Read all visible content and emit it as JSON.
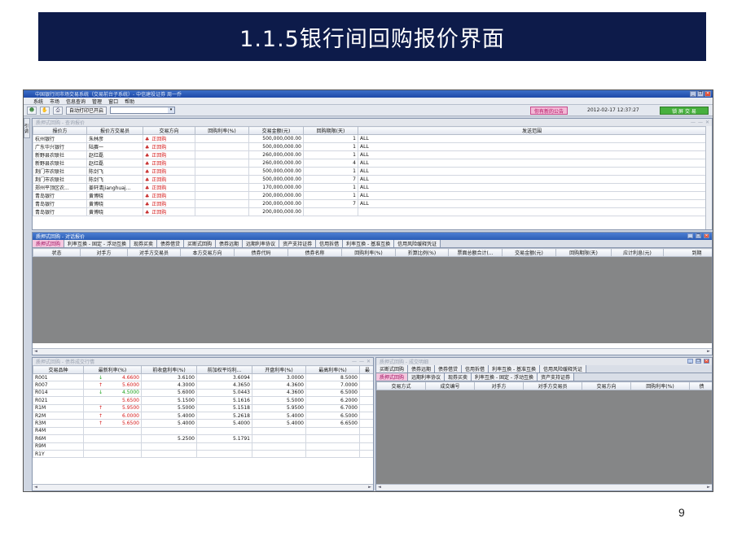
{
  "slide": {
    "title": "1.1.5银行间回购报价界面",
    "page_number": "9"
  },
  "app": {
    "window_title": "中国银行间市场交易系统（交易前台子系统）- 中信建投证券  周一乔",
    "menu": [
      "系统",
      "市场",
      "信息查询",
      "管理",
      "窗口",
      "帮助"
    ],
    "toolbar": {
      "auto_print_label": "自动打印已开启",
      "notice_label": "你有新的公告",
      "clock": "2012-02-17 12:37:27",
      "lock_label": "锁 屏 交 易"
    },
    "side_label": "引  调"
  },
  "quote_query": {
    "title": "质押式回购 - 查询报价",
    "columns": [
      "报价方",
      "报价方交易员",
      "交易方向",
      "回购利率(%)",
      "交易金额(元)",
      "回购期限(天)",
      "发送范围"
    ],
    "rows": [
      [
        "杭州银行",
        "朱林彦",
        "正回购",
        "",
        "500,000,000.00",
        "1",
        "ALL"
      ],
      [
        "广东华兴银行",
        "陆赛一",
        "正回购",
        "",
        "500,000,000.00",
        "1",
        "ALL"
      ],
      [
        "新野县农联社",
        "赵红磊",
        "正回购",
        "",
        "260,000,000.00",
        "1",
        "ALL"
      ],
      [
        "新野县农联社",
        "赵红磊",
        "正回购",
        "",
        "260,000,000.00",
        "4",
        "ALL"
      ],
      [
        "荆门市农联社",
        "陈剑飞",
        "正回购",
        "",
        "500,000,000.00",
        "1",
        "ALL"
      ],
      [
        "荆门市农联社",
        "陈剑飞",
        "正回购",
        "",
        "500,000,000.00",
        "7",
        "ALL"
      ],
      [
        "郑州平顶区农...",
        "姜轩清jianghuaj...",
        "正回购",
        "",
        "170,000,000.00",
        "1",
        "ALL"
      ],
      [
        "青岛银行",
        "黄博晓",
        "正回购",
        "",
        "200,000,000.00",
        "1",
        "ALL"
      ],
      [
        "青岛银行",
        "黄博晓",
        "正回购",
        "",
        "200,000,000.00",
        "7",
        "ALL"
      ],
      [
        "青岛银行",
        "黄博晓",
        "正回购",
        "",
        "200,000,000.00",
        "",
        ""
      ]
    ]
  },
  "dialog_quote": {
    "title": "质押式回购 - 对话报价",
    "tabs": [
      "质押式回购",
      "利率互换 - 固定 - 浮动互换",
      "现券买卖",
      "债券借贷",
      "买断式回购",
      "债券远期",
      "远期利率协议",
      "资产支持证券",
      "信用拆借",
      "利率互换 - 基准互换",
      "信用风险缓释凭证"
    ],
    "columns": [
      "状态",
      "对手方",
      "对手方交易员",
      "本方交易方向",
      "债券代码",
      "债券名称",
      "回购利率(%)",
      "折算比例(%)",
      "票面总额合计(...",
      "交易金额(元)",
      "回购期限(天)",
      "应计利息(元)",
      "到期"
    ]
  },
  "market": {
    "title": "质押式回购 - 债券成交行情",
    "columns": [
      "交易品种",
      "最新利率(%)",
      "前收盘利率(%)",
      "前加权平均利...",
      "开盘利率(%)",
      "最高利率(%)",
      "最"
    ],
    "rows": [
      {
        "name": "R001",
        "arrow": "↓",
        "color": "red",
        "latest": "4.6600",
        "prev_close": "3.6100",
        "wavg": "3.6094",
        "open": "3.0000",
        "high": "8.5000"
      },
      {
        "name": "R007",
        "arrow": "↑",
        "color": "red",
        "latest": "5.6000",
        "prev_close": "4.3000",
        "wavg": "4.3650",
        "open": "4.3600",
        "high": "7.0000"
      },
      {
        "name": "R014",
        "arrow": "↓",
        "color": "green",
        "latest": "4.5000",
        "prev_close": "5.6000",
        "wavg": "5.0443",
        "open": "4.3600",
        "high": "6.5000"
      },
      {
        "name": "R021",
        "arrow": "",
        "color": "red",
        "latest": "5.6500",
        "prev_close": "5.1500",
        "wavg": "5.1616",
        "open": "5.5000",
        "high": "6.2000"
      },
      {
        "name": "R1M",
        "arrow": "↑",
        "color": "red",
        "latest": "5.9500",
        "prev_close": "5.5000",
        "wavg": "5.1518",
        "open": "5.9500",
        "high": "6.7000"
      },
      {
        "name": "R2M",
        "arrow": "↑",
        "color": "red",
        "latest": "6.0000",
        "prev_close": "5.4000",
        "wavg": "5.2618",
        "open": "5.4000",
        "high": "6.5000"
      },
      {
        "name": "R3M",
        "arrow": "↑",
        "color": "red",
        "latest": "5.6500",
        "prev_close": "5.4000",
        "wavg": "5.4000",
        "open": "5.4000",
        "high": "6.6500"
      },
      {
        "name": "R4M",
        "arrow": "",
        "color": "",
        "latest": "",
        "prev_close": "",
        "wavg": "",
        "open": "",
        "high": ""
      },
      {
        "name": "R6M",
        "arrow": "",
        "color": "",
        "latest": "",
        "prev_close": "5.2500",
        "wavg": "5.1791",
        "open": "",
        "high": ""
      },
      {
        "name": "R9M",
        "arrow": "",
        "color": "",
        "latest": "",
        "prev_close": "",
        "wavg": "",
        "open": "",
        "high": ""
      },
      {
        "name": "R1Y",
        "arrow": "",
        "color": "",
        "latest": "",
        "prev_close": "",
        "wavg": "",
        "open": "",
        "high": ""
      }
    ]
  },
  "deals": {
    "title": "质押式回购 - 成交明细",
    "tabs_row1": [
      "买断式回购",
      "债券远期",
      "债券借贷",
      "信用拆借",
      "利率互换 - 基准互换",
      "信用风险缓释凭证"
    ],
    "tabs_row2": [
      "质押式回购",
      "远期利率协议",
      "现券买卖",
      "利率互换 - 固定 - 浮动互换",
      "资产支持证券"
    ],
    "columns": [
      "交易方式",
      "成交编号",
      "对手方",
      "对手方交易员",
      "交易方向",
      "回购利率(%)",
      "债"
    ]
  }
}
